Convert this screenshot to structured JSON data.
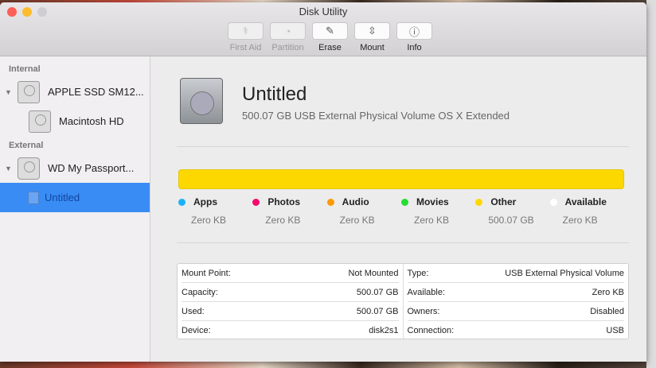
{
  "window": {
    "title": "Disk Utility"
  },
  "toolbar": [
    {
      "label": "First Aid",
      "icon": "stethoscope-icon",
      "glyph": "⚕",
      "enabled": false
    },
    {
      "label": "Partition",
      "icon": "pie-icon",
      "glyph": "◔",
      "enabled": false
    },
    {
      "label": "Erase",
      "icon": "erase-icon",
      "glyph": "✎",
      "enabled": true
    },
    {
      "label": "Mount",
      "icon": "mount-icon",
      "glyph": "⇳",
      "enabled": true
    },
    {
      "label": "Info",
      "icon": "info-icon",
      "glyph": "ⓘ",
      "enabled": true
    }
  ],
  "sidebar": {
    "internal_label": "Internal",
    "external_label": "External",
    "items": [
      {
        "label": "APPLE SSD SM12..."
      },
      {
        "label": "Macintosh HD"
      },
      {
        "label": "WD My Passport..."
      },
      {
        "label": "Untitled"
      }
    ]
  },
  "volume": {
    "name": "Untitled",
    "description": "500.07 GB USB External Physical Volume OS X Extended"
  },
  "usage": {
    "accent": "#fdd800",
    "other_fraction": 1.0,
    "legend": [
      {
        "label": "Apps",
        "value": "Zero KB",
        "color": "#1ab2f7"
      },
      {
        "label": "Photos",
        "value": "Zero KB",
        "color": "#f5086e"
      },
      {
        "label": "Audio",
        "value": "Zero KB",
        "color": "#fb9a04"
      },
      {
        "label": "Movies",
        "value": "Zero KB",
        "color": "#26dc32"
      },
      {
        "label": "Other",
        "value": "500.07 GB",
        "color": "#fdd800"
      },
      {
        "label": "Available",
        "value": "Zero KB",
        "color": "#ffffff"
      }
    ]
  },
  "info": {
    "left": [
      {
        "k": "Mount Point:",
        "v": "Not Mounted"
      },
      {
        "k": "Capacity:",
        "v": "500.07 GB"
      },
      {
        "k": "Used:",
        "v": "500.07 GB"
      },
      {
        "k": "Device:",
        "v": "disk2s1"
      }
    ],
    "right": [
      {
        "k": "Type:",
        "v": "USB External Physical Volume"
      },
      {
        "k": "Available:",
        "v": "Zero KB"
      },
      {
        "k": "Owners:",
        "v": "Disabled"
      },
      {
        "k": "Connection:",
        "v": "USB"
      }
    ]
  }
}
